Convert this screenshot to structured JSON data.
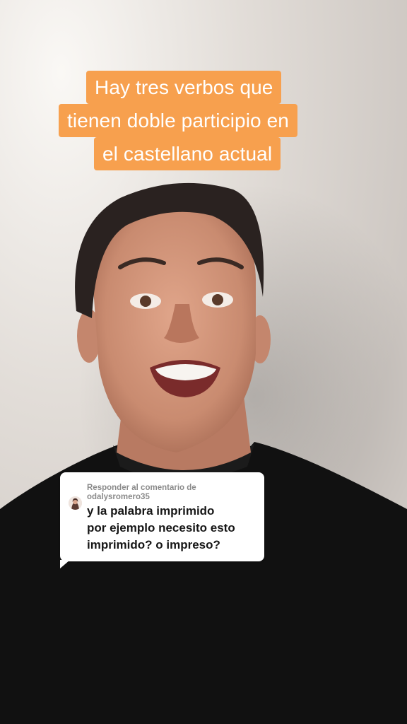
{
  "caption": {
    "lines": [
      "Hay tres verbos que",
      "tienen doble participio en",
      "el castellano actual"
    ],
    "background_color": "#f7a04e",
    "text_color": "#ffffff"
  },
  "reply": {
    "header": "Responder al comentario de",
    "username": "odalysromero35",
    "avatar_icon": "user-avatar-icon",
    "comment_lines": [
      "y la palabra imprimido",
      "por ejemplo necesito esto",
      "imprimido? o impreso?"
    ]
  }
}
